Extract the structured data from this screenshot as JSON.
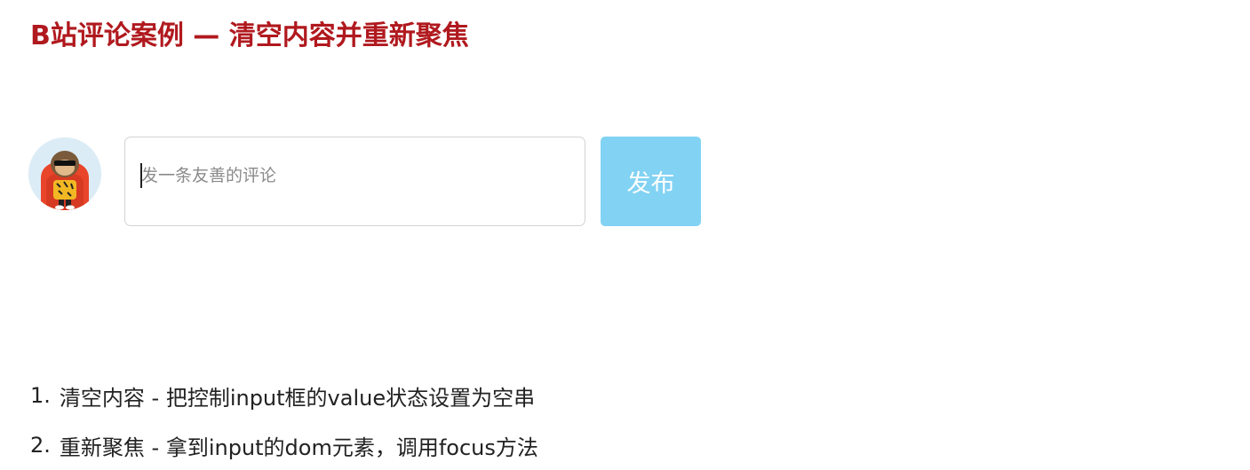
{
  "page": {
    "title": "B站评论案例 — 清空内容并重新聚焦"
  },
  "comment_box": {
    "placeholder": "发一条友善的评论",
    "value": "",
    "publish_label": "发布"
  },
  "colors": {
    "title": "#b0191e",
    "publish_button": "#82d2f3",
    "input_border": "#d3d3d3"
  },
  "notes": [
    {
      "number": "1.",
      "text": "清空内容 - 把控制input框的value状态设置为空串"
    },
    {
      "number": "2.",
      "text": "重新聚焦 - 拿到input的dom元素，调用focus方法"
    }
  ]
}
